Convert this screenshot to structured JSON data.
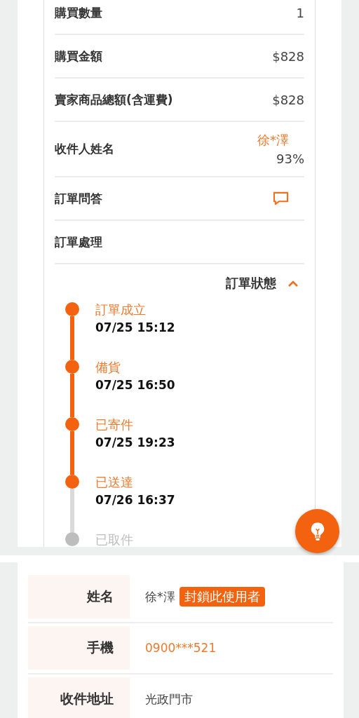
{
  "order_info": {
    "rows": [
      {
        "label": "購買數量",
        "value": "1",
        "kind": "text"
      },
      {
        "label": "購買金額",
        "value": "$828",
        "kind": "text"
      },
      {
        "label": "賣家商品總額(含運費)",
        "value": "$828",
        "kind": "text"
      },
      {
        "label": "收件人姓名",
        "value": "徐*澤",
        "note": "93%",
        "kind": "name"
      },
      {
        "label": "訂單問答",
        "kind": "chat"
      },
      {
        "label": "訂單處理",
        "kind": "text"
      }
    ]
  },
  "order_status": {
    "title": "訂單狀態",
    "expanded": true,
    "steps": [
      {
        "label": "訂單成立",
        "time": "07/25 15:12",
        "done": true
      },
      {
        "label": "備貨",
        "time": "07/25 16:50",
        "done": true
      },
      {
        "label": "已寄件",
        "time": "07/25 19:23",
        "done": true
      },
      {
        "label": "已送達",
        "time": "07/26 16:37",
        "done": true
      },
      {
        "label": "已取件",
        "done": false
      }
    ]
  },
  "recipient": {
    "rows": [
      {
        "label": "姓名",
        "value": "徐*澤",
        "action": "封鎖此使用者",
        "kind": "name"
      },
      {
        "label": "手機",
        "value": "0900***521",
        "kind": "phone"
      },
      {
        "label": "收件地址",
        "value": "光政門市",
        "kind": "text"
      }
    ]
  }
}
